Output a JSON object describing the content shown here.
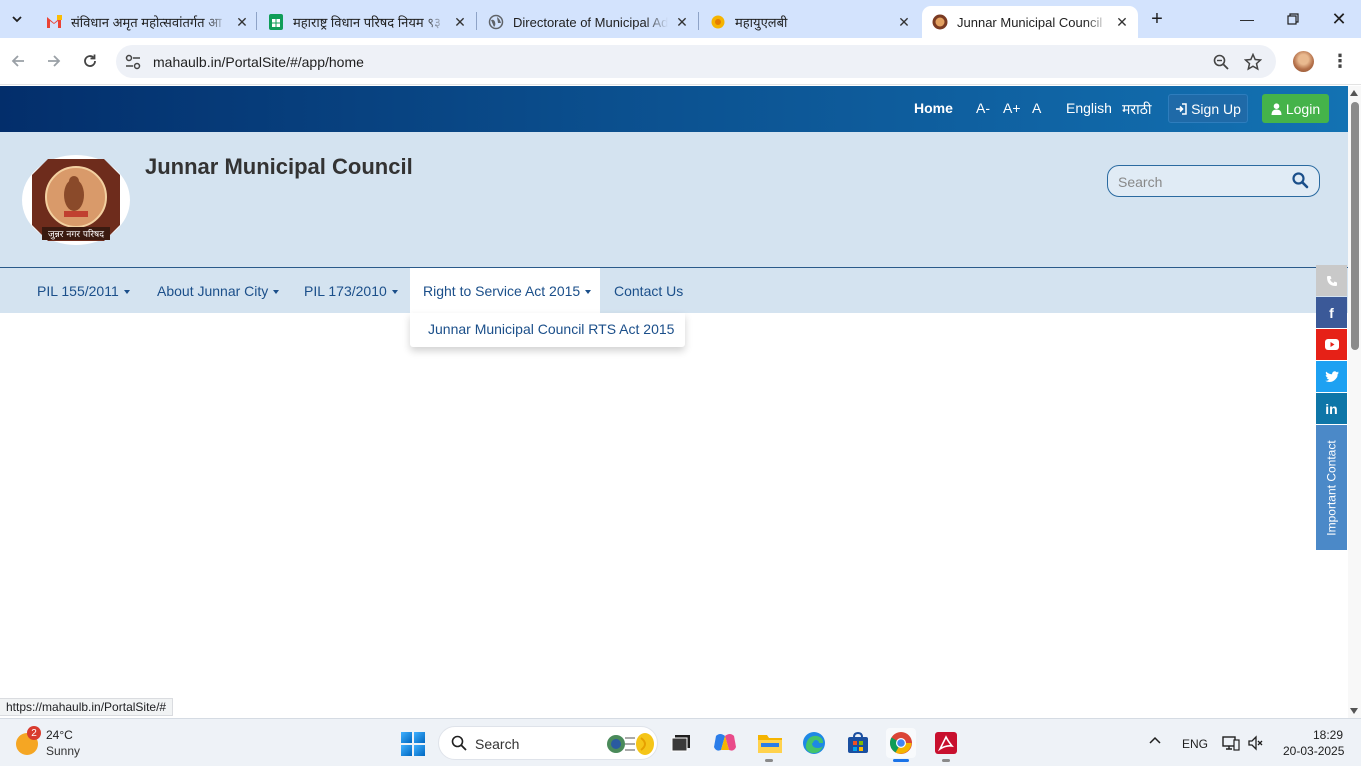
{
  "browser": {
    "tabs": [
      {
        "title": "संविधान अमृत महोत्सवांतर्गत आ",
        "favicon": "gmail-icon",
        "active": false
      },
      {
        "title": "महाराष्ट्र विधान परिषद नियम ९३",
        "favicon": "sheets-icon",
        "active": false
      },
      {
        "title": "Directorate of Municipal Adm",
        "favicon": "globe-icon",
        "active": false
      },
      {
        "title": "महायुएलबी",
        "favicon": "sun-logo-icon",
        "active": false
      },
      {
        "title": "Junnar Municipal Council",
        "favicon": "emblem-icon",
        "active": true
      }
    ],
    "address": "mahaulb.in/PortalSite/#/app/home",
    "status_url": "https://mahaulb.in/PortalSite/#"
  },
  "topbar": {
    "home": "Home",
    "font_decrease": "A-",
    "font_increase": "A+",
    "font_reset": "A",
    "lang_english": "English",
    "lang_marathi": "मराठी",
    "signup": "Sign Up",
    "login": "Login"
  },
  "header": {
    "title": "Junnar Municipal Council",
    "search_placeholder": "Search",
    "logo_text": "जुन्नर नगर परिषद"
  },
  "nav": {
    "items": [
      {
        "label": "PIL 155/2011",
        "has_dropdown": true
      },
      {
        "label": "About Junnar City",
        "has_dropdown": true
      },
      {
        "label": "PIL 173/2010",
        "has_dropdown": true
      },
      {
        "label": "Right to Service Act 2015",
        "has_dropdown": true
      },
      {
        "label": "Contact Us",
        "has_dropdown": false
      }
    ],
    "open_dropdown": {
      "items": [
        "Junnar Municipal Council RTS Act 2015"
      ]
    }
  },
  "sidebar": {
    "social": [
      "phone-icon",
      "facebook-icon",
      "youtube-icon",
      "twitter-icon",
      "linkedin-icon"
    ],
    "important_contact": "Important Contact"
  },
  "taskbar": {
    "weather": {
      "temp": "24°C",
      "desc": "Sunny",
      "badge": "2"
    },
    "search": "Search",
    "lang": "ENG",
    "time": "18:29",
    "date": "20-03-2025"
  },
  "colors": {
    "topbar_dark": "#032e6b",
    "topbar_light": "#1372b3",
    "header_bg": "#d4e3f0",
    "nav_text": "#1b4f8a",
    "login_green": "#45b34a",
    "facebook": "#3b5998",
    "youtube": "#e62117",
    "twitter": "#1da1f2",
    "linkedin": "#0e76a8",
    "important_contact": "#4b89c8"
  }
}
